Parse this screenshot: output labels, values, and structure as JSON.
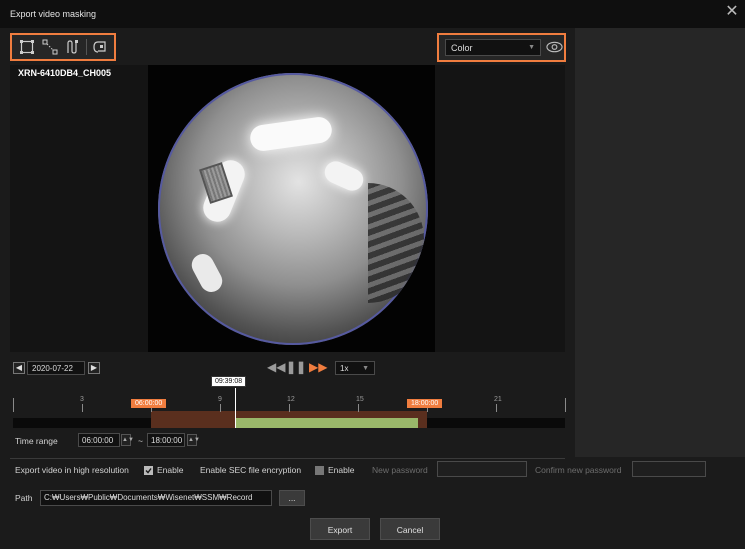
{
  "window": {
    "title": "Export video masking",
    "close_icon": "close-icon"
  },
  "toolbar": {
    "tools": [
      "rectangle-mask-icon",
      "polygon-mask-icon",
      "manual-track-icon",
      "auto-track-icon"
    ]
  },
  "color": {
    "selected": "Color",
    "eye_icon": "eye-icon"
  },
  "camera": {
    "label": "XRN-6410DB4_CH005"
  },
  "playback": {
    "date": "2020-07-22",
    "speed": "1x"
  },
  "timeline": {
    "current_time": "09:39:08",
    "range_start_label": "06:00:00",
    "range_end_label": "18:00:00",
    "ticks": [
      "3",
      "9",
      "12",
      "15",
      "21"
    ],
    "range_start_hour": 6,
    "range_end_hour": 18,
    "recorded_start_hour": 9.65,
    "recorded_end_hour": 17.6,
    "current_hour": 9.65
  },
  "time_range": {
    "label": "Time range",
    "start": "06:00:00",
    "end": "18:00:00",
    "separator": "~"
  },
  "export_options": {
    "high_res_label": "Export video in high resolution",
    "high_res_enable": "Enable",
    "sec_label": "Enable SEC file encryption",
    "sec_enable": "Enable",
    "new_password_label": "New password",
    "confirm_password_label": "Confirm new password"
  },
  "path": {
    "label": "Path",
    "value": "C:₩Users₩Public₩Documents₩Wisenet₩SSM₩Record",
    "browse": "..."
  },
  "buttons": {
    "export": "Export",
    "cancel": "Cancel"
  },
  "colors": {
    "accent": "#f07d3f",
    "recorded": "#9ab86a",
    "range": "#5a2f1e"
  }
}
